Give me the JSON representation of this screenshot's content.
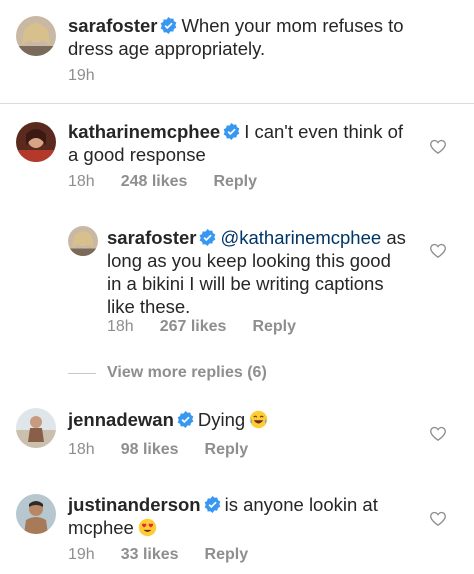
{
  "caption": {
    "username": "sarafoster",
    "text_line1": "When your mom refuses to",
    "text_line2": "dress age appropriately.",
    "time": "19h"
  },
  "comments": [
    {
      "username": "katharinemcphee",
      "text_line1": "I can't even think of",
      "text_line2": "a good response",
      "time": "18h",
      "likes": "248 likes",
      "reply": "Reply"
    },
    {
      "username": "sarafoster",
      "mention": "@katharinemcphee",
      "text_line1_tail": "as",
      "text_line2": "long as you keep looking this good",
      "text_line3": "in a bikini I will be writing captions",
      "text_line4": "like these.",
      "time": "18h",
      "likes": "267 likes",
      "reply": "Reply"
    },
    {
      "username": "jennadewan",
      "text_line1": "Dying",
      "emoji": "face-with-tears-of-joy",
      "time": "18h",
      "likes": "98 likes",
      "reply": "Reply"
    },
    {
      "username": "justinanderson",
      "text_line1": "is anyone lookin at",
      "text_line2": "mcphee",
      "emoji": "heart-eyes",
      "time": "19h",
      "likes": "33 likes",
      "reply": "Reply"
    }
  ],
  "view_more": "View more replies (6)",
  "colors": {
    "verified": "#3897f0",
    "mention": "#003569",
    "muted": "#8e8e8e",
    "text": "#262626"
  }
}
